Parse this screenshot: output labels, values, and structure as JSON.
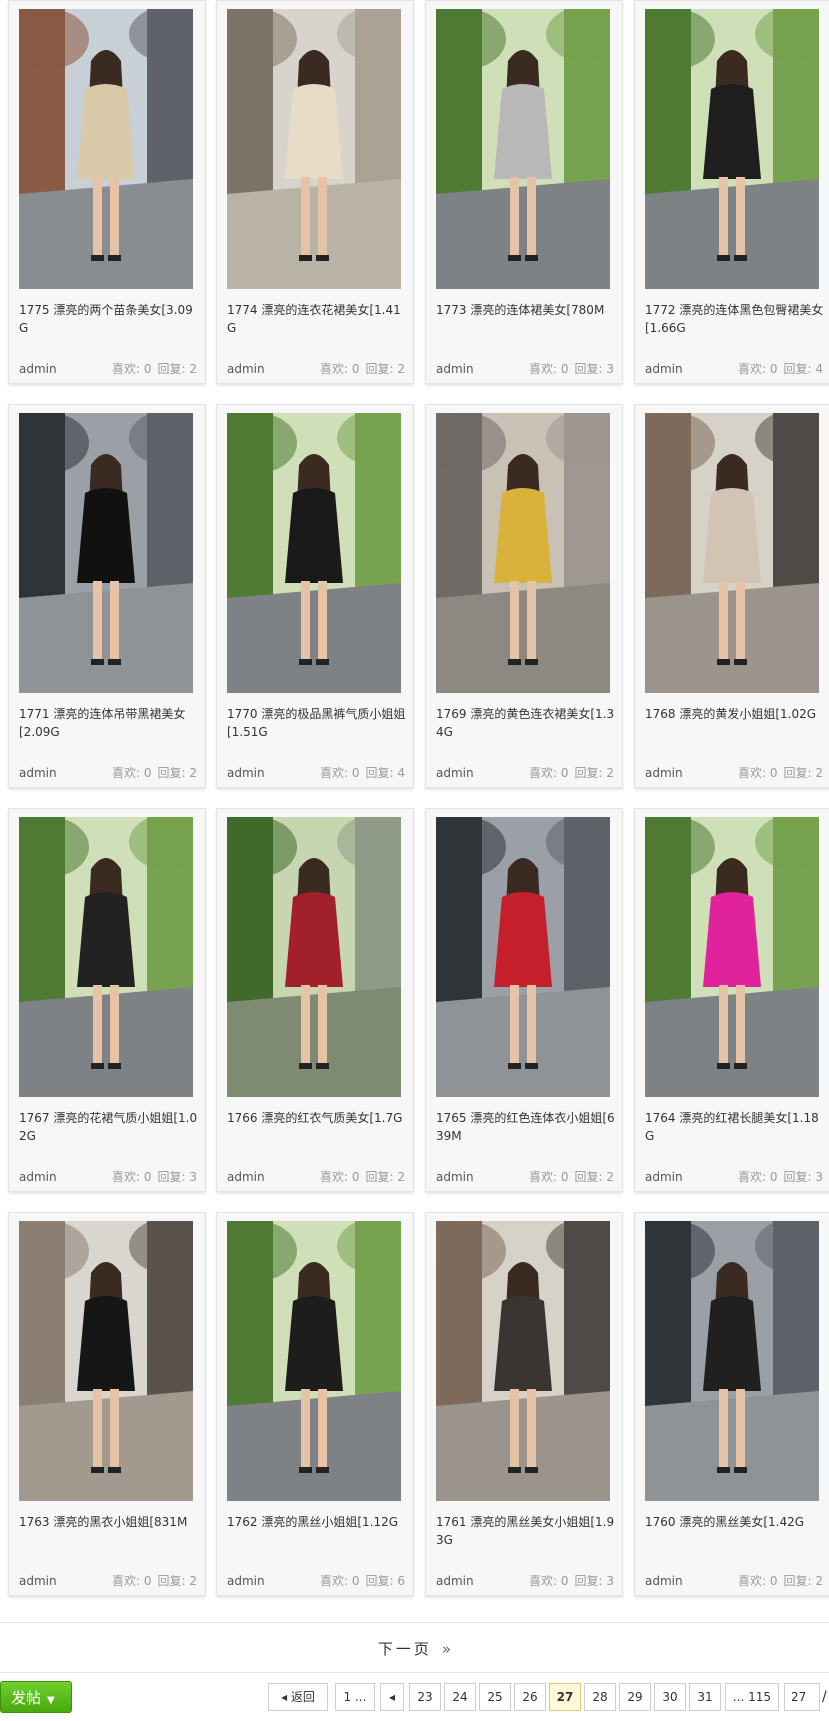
{
  "posts": [
    {
      "title": "1775 漂亮的两个苗条美女[3.09G",
      "author": "admin",
      "likes_label": "喜欢: 0",
      "replies_label": "回复: 2",
      "scene": "street-brick"
    },
    {
      "title": "1774 漂亮的连衣花裙美女[1.41G",
      "author": "admin",
      "likes_label": "喜欢: 0",
      "replies_label": "回复: 2",
      "scene": "mall-arcade"
    },
    {
      "title": "1773 漂亮的连体裙美女[780M",
      "author": "admin",
      "likes_label": "喜欢: 0",
      "replies_label": "回复: 3",
      "scene": "tree-street"
    },
    {
      "title": "1772 漂亮的连体黑色包臀裙美女[1.66G",
      "author": "admin",
      "likes_label": "喜欢: 0",
      "replies_label": "回复: 4",
      "scene": "tree-street"
    },
    {
      "title": "1771 漂亮的连体吊带黑裙美女[2.09G",
      "author": "admin",
      "likes_label": "喜欢: 0",
      "replies_label": "回复: 2",
      "scene": "storefront"
    },
    {
      "title": "1770 漂亮的极品黑裤气质小姐姐[1.51G",
      "author": "admin",
      "likes_label": "喜欢: 0",
      "replies_label": "回复: 4",
      "scene": "tree-street"
    },
    {
      "title": "1769 漂亮的黄色连衣裙美女[1.34G",
      "author": "admin",
      "likes_label": "喜欢: 0",
      "replies_label": "回复: 2",
      "scene": "shop-street"
    },
    {
      "title": "1768 漂亮的黄发小姐姐[1.02G",
      "author": "admin",
      "likes_label": "喜欢: 0",
      "replies_label": "回复: 2",
      "scene": "brick-house"
    },
    {
      "title": "1767 漂亮的花裙气质小姐姐[1.02G",
      "author": "admin",
      "likes_label": "喜欢: 0",
      "replies_label": "回复: 3",
      "scene": "tree-street"
    },
    {
      "title": "1766 漂亮的红衣气质美女[1.7G",
      "author": "admin",
      "likes_label": "喜欢: 0",
      "replies_label": "回复: 2",
      "scene": "park"
    },
    {
      "title": "1765 漂亮的红色连体衣小姐姐[639M",
      "author": "admin",
      "likes_label": "喜欢: 0",
      "replies_label": "回复: 2",
      "scene": "storefront"
    },
    {
      "title": "1764 漂亮的红裙长腿美女[1.18G",
      "author": "admin",
      "likes_label": "喜欢: 0",
      "replies_label": "回复: 3",
      "scene": "tree-street"
    },
    {
      "title": "1763 漂亮的黑衣小姐姐[831M",
      "author": "admin",
      "likes_label": "喜欢: 0",
      "replies_label": "回复: 2",
      "scene": "cafe"
    },
    {
      "title": "1762 漂亮的黑丝小姐姐[1.12G",
      "author": "admin",
      "likes_label": "喜欢: 0",
      "replies_label": "回复: 6",
      "scene": "tree-street"
    },
    {
      "title": "1761 漂亮的黑丝美女小姐姐[1.93G",
      "author": "admin",
      "likes_label": "喜欢: 0",
      "replies_label": "回复: 3",
      "scene": "brick-house"
    },
    {
      "title": "1760 漂亮的黑丝美女[1.42G",
      "author": "admin",
      "likes_label": "喜欢: 0",
      "replies_label": "回复: 2",
      "scene": "storefront"
    }
  ],
  "footer": {
    "next_page": "下一页",
    "next_arrow": "»",
    "post_button": "发帖",
    "pager": {
      "back": "返回",
      "first": "1 ...",
      "pages": [
        "23",
        "24",
        "25",
        "26",
        "27",
        "28",
        "29",
        "30",
        "31"
      ],
      "current": "27",
      "last": "... 115",
      "input_value": "27",
      "slash": "/"
    }
  },
  "colors": {
    "post_button": "#5cbd1f",
    "current_page_bg": "#fff9d8"
  }
}
